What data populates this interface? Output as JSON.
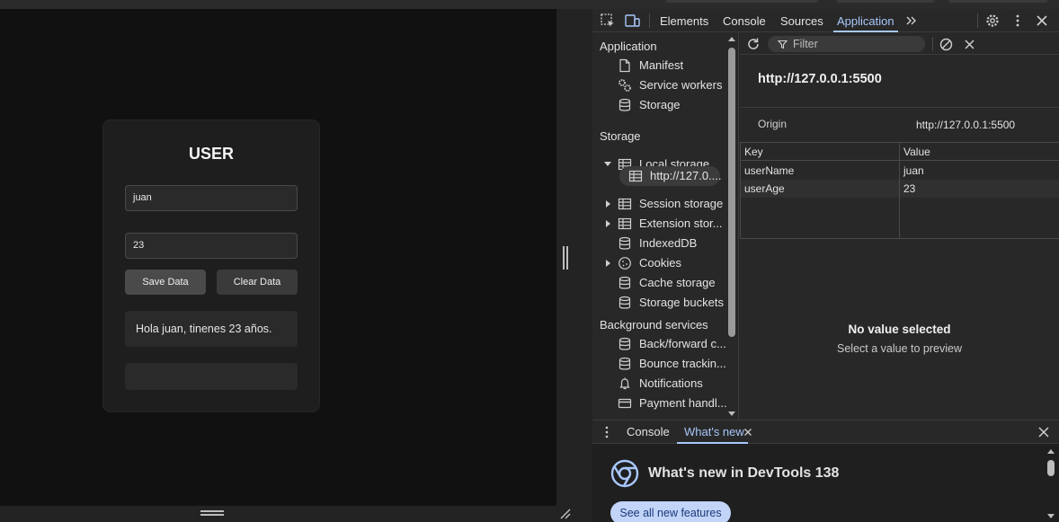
{
  "page": {
    "card_title": "USER",
    "name_value": "juan",
    "age_value": "23",
    "save_label": "Save Data",
    "clear_label": "Clear Data",
    "greeting": "Hola juan, tinenes 23 años."
  },
  "devtools": {
    "tabs": [
      "Elements",
      "Console",
      "Sources",
      "Application"
    ],
    "active_tab": "Application",
    "sidebar": {
      "application_header": "Application",
      "application_items": [
        "Manifest",
        "Service workers",
        "Storage"
      ],
      "storage_header": "Storage",
      "storage_items": {
        "local_storage": "Local storage",
        "local_origin": "http://127.0....",
        "session_storage": "Session storage",
        "extension_storage": "Extension stor...",
        "indexeddb": "IndexedDB",
        "cookies": "Cookies",
        "cache_storage": "Cache storage",
        "storage_buckets": "Storage buckets"
      },
      "background_header": "Background services",
      "background_items": [
        "Back/forward c...",
        "Bounce trackin...",
        "Notifications",
        "Payment handl..."
      ]
    },
    "filter_placeholder": "Filter",
    "origin_url": "http://127.0.0.1:5500",
    "origin_label": "Origin",
    "origin_value": "http://127.0.0.1:5500",
    "table": {
      "key_header": "Key",
      "value_header": "Value",
      "rows": [
        {
          "key": "userName",
          "value": "juan"
        },
        {
          "key": "userAge",
          "value": "23"
        }
      ]
    },
    "preview_title": "No value selected",
    "preview_sub": "Select a value to preview",
    "drawer": {
      "tabs": [
        "Console",
        "What's new"
      ],
      "active_tab": "What's new",
      "title": "What's new in DevTools 138",
      "button": "See all new features"
    }
  },
  "colors": {
    "accent": "#a8c7fa",
    "page_bg": "#111111",
    "card_bg": "#1e1e1e",
    "devtools_bg": "#282828"
  }
}
